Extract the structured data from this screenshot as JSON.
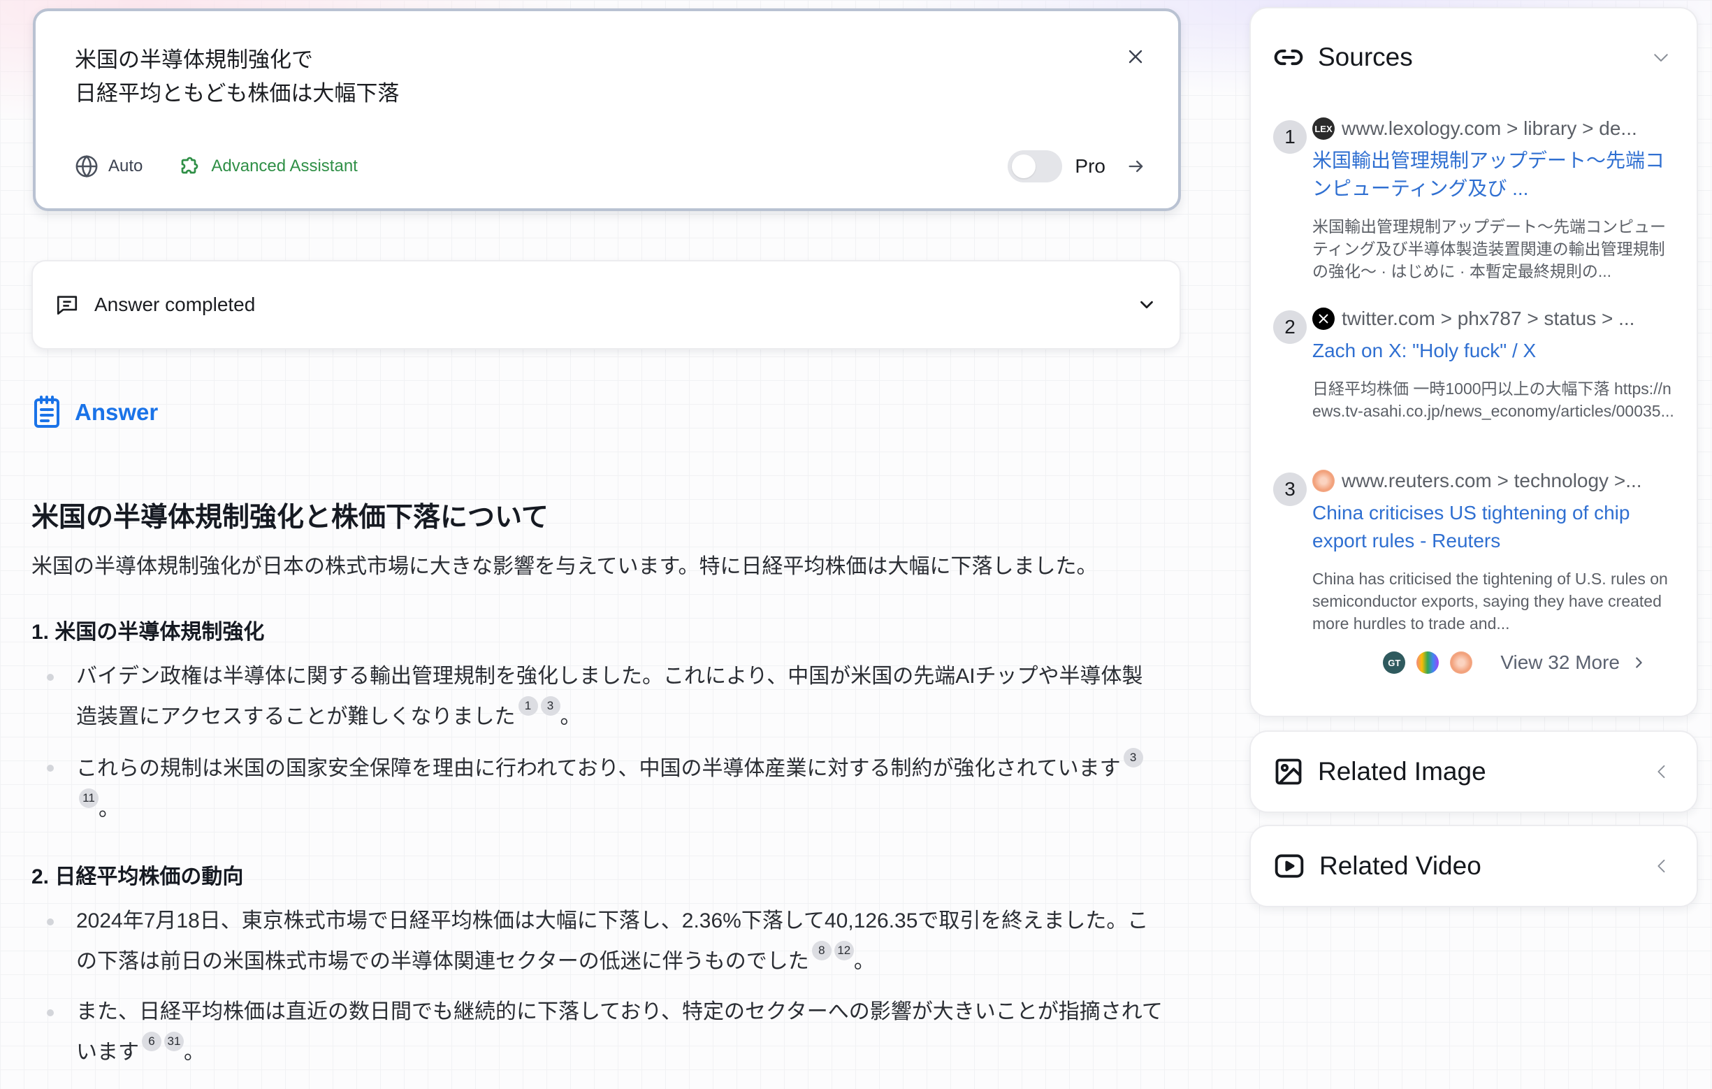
{
  "query": {
    "text": "米国の半導体規制強化で\n日経平均ともども株価は大幅下落",
    "close_icon": "close-icon",
    "mode_auto_label": "Auto",
    "mode_auto_icon": "globe-icon",
    "assistant_label": "Advanced Assistant",
    "assistant_icon": "puzzle-icon",
    "pro_label": "Pro",
    "pro_enabled": false,
    "submit_icon": "arrow-right-icon"
  },
  "status": {
    "label": "Answer completed",
    "icon": "message-square-icon",
    "chevron": "chevron-down-icon"
  },
  "answer": {
    "header_label": "Answer",
    "header_icon": "notepad-icon",
    "heading": "米国の半導体規制強化と株価下落について",
    "intro": "米国の半導体規制強化が日本の株式市場に大きな影響を与えています。特に日経平均株価は大幅に下落しました。",
    "sections": [
      {
        "title": "1. 米国の半導体規制強化",
        "bullets": [
          {
            "text": "バイデン政権は半導体に関する輸出管理規制を強化しました。これにより、中国が米国の先端AIチップや半導体製造装置にアクセスすることが難しくなりました",
            "citations": [
              "1",
              "3"
            ],
            "end": "。"
          },
          {
            "text": "これらの規制は米国の国家安全保障を理由に行われており、中国の半導体産業に対する制約が強化されています",
            "citations": [
              "3",
              "11"
            ],
            "end": "。"
          }
        ]
      },
      {
        "title": "2. 日経平均株価の動向",
        "bullets": [
          {
            "text": "2024年7月18日、東京株式市場で日経平均株価は大幅に下落し、2.36%下落して40,126.35で取引を終えました。この下落は前日の米国株式市場での半導体関連セクターの低迷に伴うものでした",
            "citations": [
              "8",
              "12"
            ],
            "end": "。"
          },
          {
            "text": "また、日経平均株価は直近の数日間でも継続的に下落しており、特定のセクターへの影響が大きいことが指摘されています",
            "citations": [
              "6",
              "31"
            ],
            "end": "。"
          }
        ]
      }
    ]
  },
  "sources": {
    "title": "Sources",
    "icon": "link-icon",
    "chevron": "chevron-down-icon",
    "items": [
      {
        "num": "1",
        "favicon_text": "LEX",
        "favicon_color": "#2b2b2b",
        "site": "www.lexology.com > library > de...",
        "title": "米国輸出管理規制アップデート～先端コンピューティング及び ...",
        "snippet": "米国輸出管理規制アップデート～先端コンピューティング及び半導体製造装置関連の輸出管理規制の強化～ · はじめに · 本暫定最終規則の..."
      },
      {
        "num": "2",
        "favicon_text": "X",
        "favicon_color": "#000000",
        "site": "twitter.com > phx787 > status > ...",
        "title": "Zach on X: \"Holy fuck\" / X",
        "snippet": "日経平均株価 一時1000円以上の大幅下落 https://news.tv-asahi.co.jp/news_economy/articles/00035..."
      },
      {
        "num": "3",
        "favicon_text": "",
        "favicon_color": "#f2a07a",
        "site": "www.reuters.com > technology >...",
        "title": "China criticises US tightening of chip export rules - Reuters",
        "snippet": "China has criticised the tightening of U.S. rules on semiconductor exports, saying they have created more hurdles to trade and..."
      }
    ],
    "more_favicons": [
      {
        "text": "GT",
        "color": "#2f5a5e"
      },
      {
        "text": "",
        "color": "#b9a6e8"
      },
      {
        "text": "",
        "color": "#f2a07a"
      }
    ],
    "more_label": "View 32 More",
    "more_icon": "chevron-right-icon"
  },
  "related_image": {
    "title": "Related Image",
    "icon": "image-icon",
    "chevron": "chevron-left-icon"
  },
  "related_video": {
    "title": "Related Video",
    "icon": "video-play-icon",
    "chevron": "chevron-left-icon"
  }
}
